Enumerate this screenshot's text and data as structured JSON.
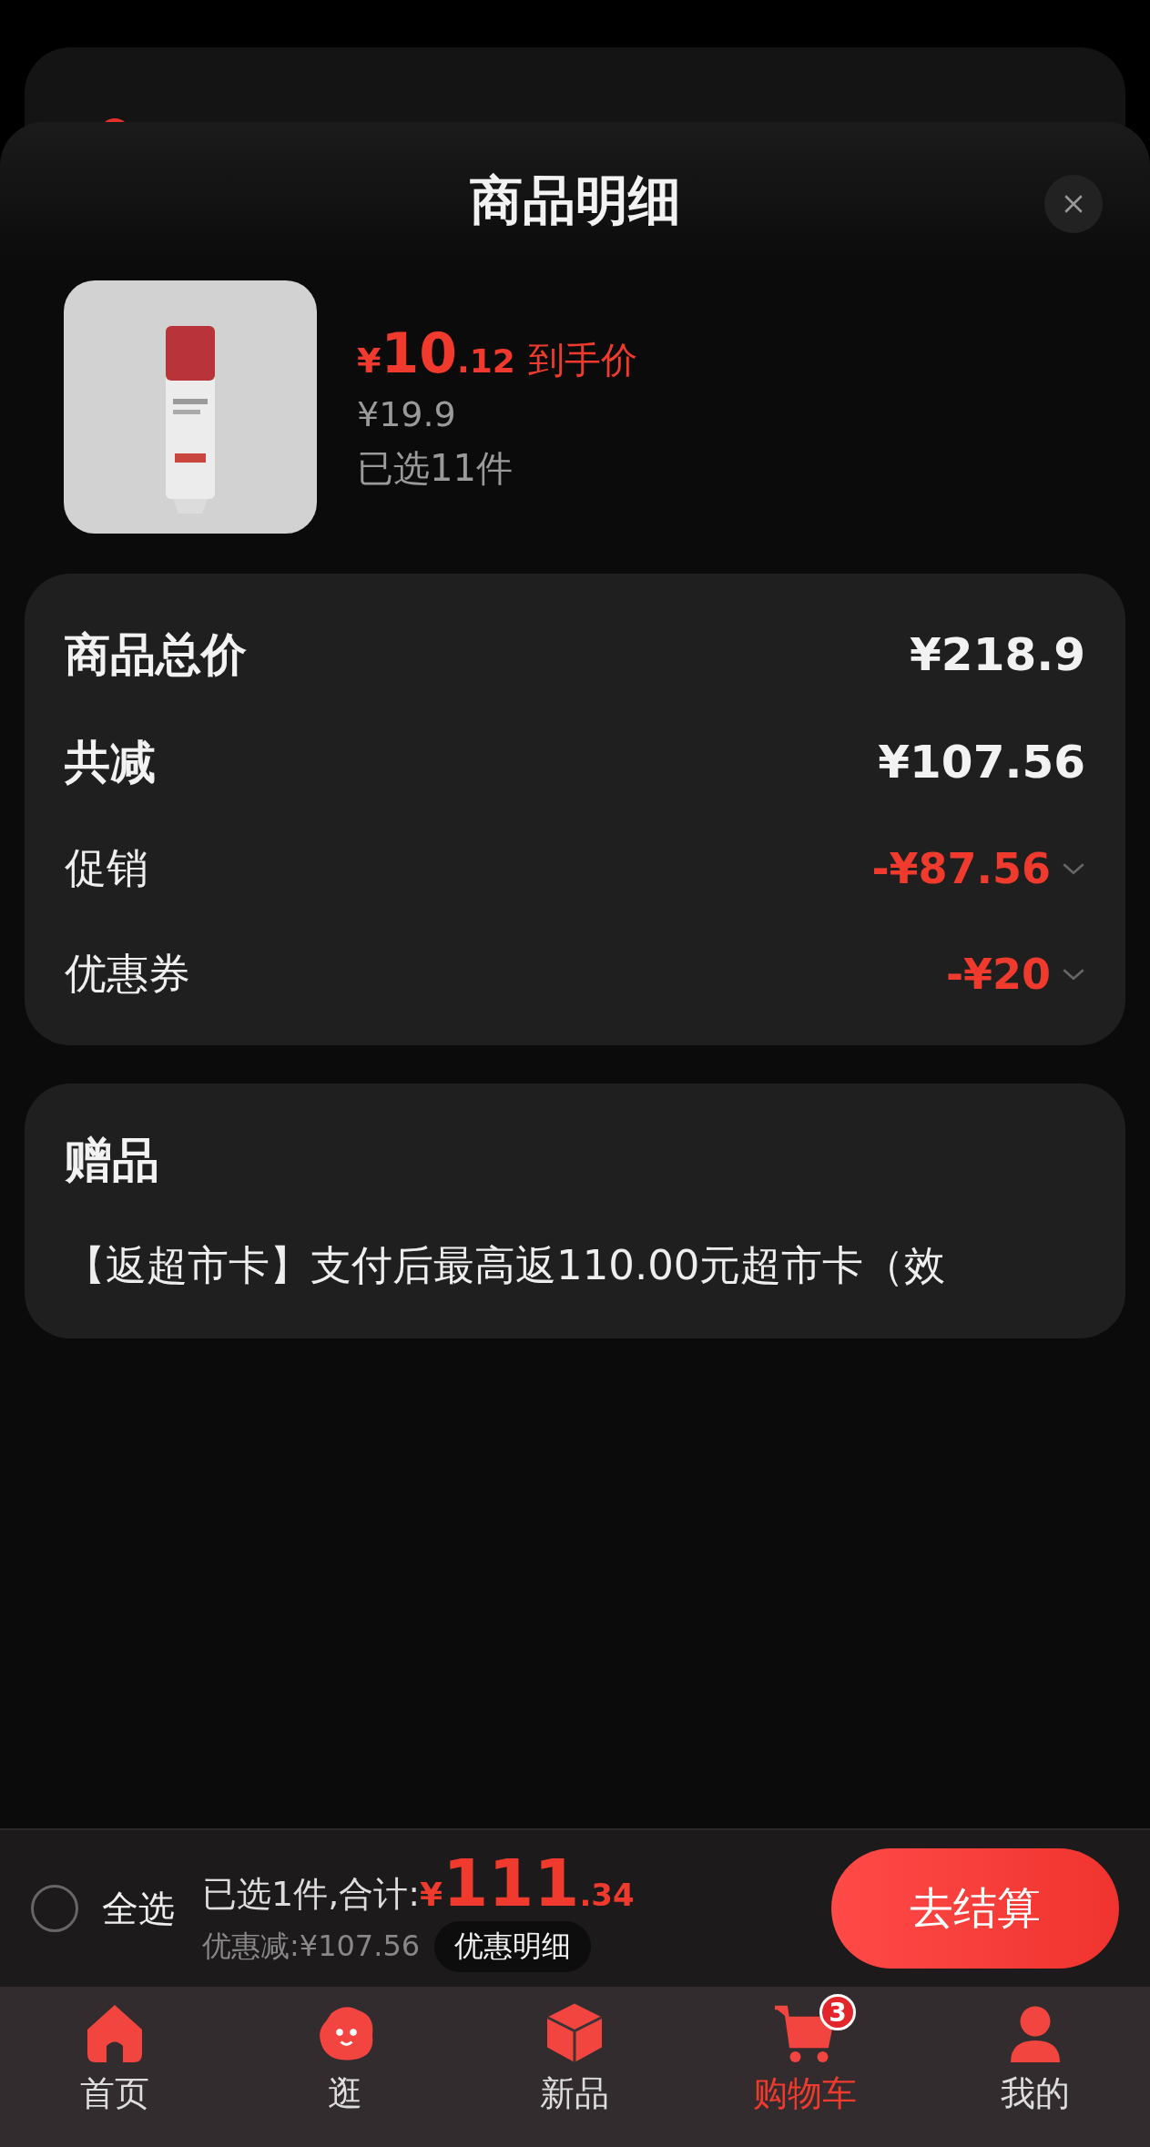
{
  "sheet": {
    "title": "商品明细"
  },
  "product": {
    "price_symbol": "¥",
    "price_int": "10",
    "price_dec": ".12",
    "price_label": "到手价",
    "original_price": "¥19.9",
    "selected_count": "已选11件"
  },
  "breakdown": [
    {
      "kind": "total",
      "label": "商品总价",
      "value": "¥218.9",
      "expandable": false
    },
    {
      "kind": "total",
      "label": "共减",
      "value": "¥107.56",
      "expandable": false
    },
    {
      "kind": "discount",
      "label": "促销",
      "value": "-¥87.56",
      "expandable": true
    },
    {
      "kind": "discount",
      "label": "优惠券",
      "value": "-¥20",
      "expandable": true
    }
  ],
  "gifts": {
    "title": "赠品",
    "text": "【返超市卡】支付后最高返110.00元超市卡（效"
  },
  "checkout_bar": {
    "select_all": {
      "label": "全选",
      "checked": false
    },
    "summary": "已选1件,合计:",
    "total_symbol": "¥",
    "total_int": "111",
    "total_dec": ".34",
    "saved": "优惠减:¥107.56",
    "details_button": "优惠明细",
    "checkout_button": "去结算"
  },
  "tab_bar": [
    {
      "label": "首页",
      "selected": false
    },
    {
      "label": "逛",
      "selected": false
    },
    {
      "label": "新品",
      "selected": false
    },
    {
      "label": "购物车",
      "selected": true,
      "badge": "3"
    },
    {
      "label": "我的",
      "selected": false
    }
  ]
}
